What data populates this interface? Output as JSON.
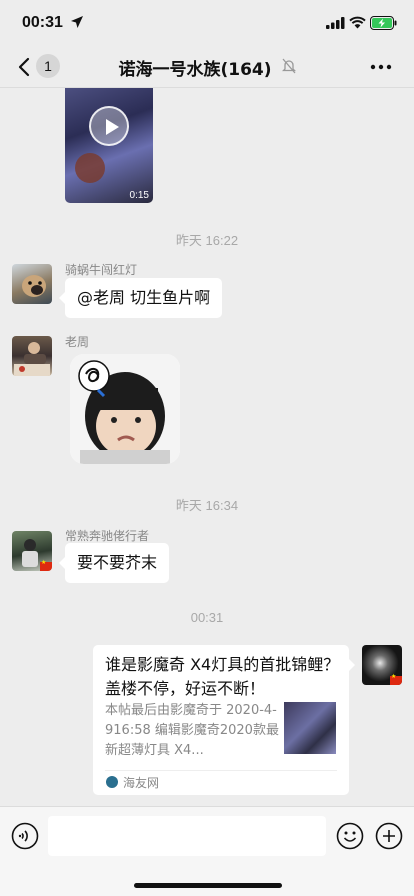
{
  "status_bar": {
    "time": "00:31",
    "icons": [
      "location-arrow-icon",
      "signal-icon",
      "wifi-icon",
      "battery-charging-icon"
    ],
    "battery_color": "#34c759"
  },
  "nav": {
    "back_icon": "chevron-left-icon",
    "unread_count": "1",
    "title": "诺海一号水族(164)",
    "mute_icon": "bell-slash-icon",
    "more_icon": "more-icon"
  },
  "messages": {
    "video": {
      "duration": "0:15"
    },
    "timestamp1": "昨天 16:22",
    "msg1": {
      "sender": "骑蜗牛闯红灯",
      "text": "@老周 切生鱼片啊"
    },
    "msg2": {
      "sender": "老周",
      "type": "sticker"
    },
    "timestamp2": "昨天 16:34",
    "msg3": {
      "sender": "常熟奔驰佬行者",
      "text": "要不要芥末"
    },
    "timestamp3": "00:31",
    "link_card": {
      "title": "谁是影魔奇 X4灯具的首批锦鲤？盖楼不停，好运不断！",
      "description": "本帖最后由影魔奇于 2020-4-916:58 编辑影魔奇2020款最新超薄灯具 X4...",
      "source": "海友网"
    }
  },
  "bottom_bar": {
    "voice_icon": "voice-icon",
    "emoji_icon": "emoji-icon",
    "plus_icon": "plus-icon"
  }
}
